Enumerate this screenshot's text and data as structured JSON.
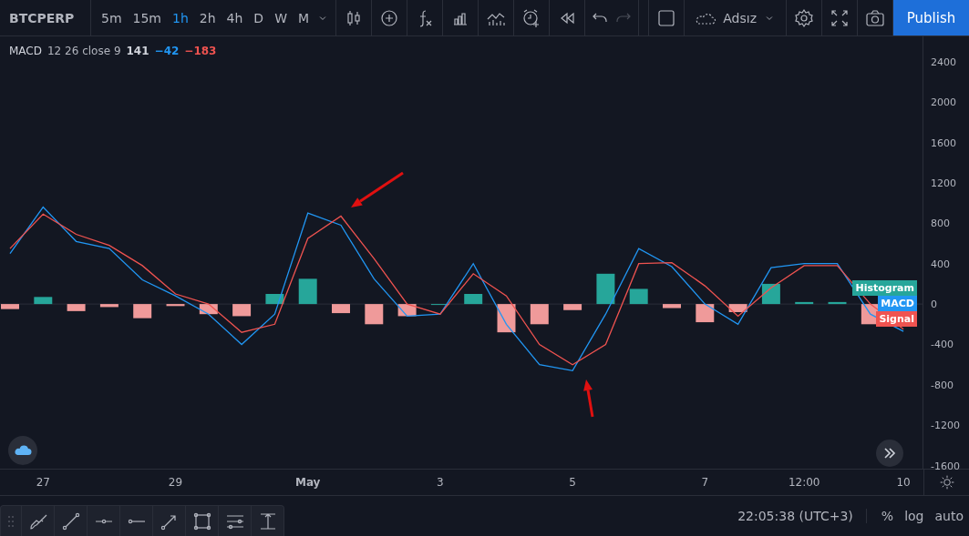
{
  "toolbar": {
    "symbol": "BTCPERP",
    "intervals": [
      {
        "label": "5m",
        "selected": false
      },
      {
        "label": "15m",
        "selected": false
      },
      {
        "label": "1h",
        "selected": true
      },
      {
        "label": "2h",
        "selected": false
      },
      {
        "label": "4h",
        "selected": false
      },
      {
        "label": "D",
        "selected": false
      },
      {
        "label": "W",
        "selected": false
      },
      {
        "label": "M",
        "selected": false
      }
    ],
    "undo": {
      "disabled": false
    },
    "redo": {
      "disabled": true
    },
    "layout_name": "Adsız",
    "publish": "Publish"
  },
  "legend": {
    "name": "MACD",
    "params": "12 26 close 9",
    "values": [
      {
        "text": "141",
        "color": "#d1d4dc"
      },
      {
        "text": "−42",
        "color": "#2196f3"
      },
      {
        "text": "−183",
        "color": "#ef5350"
      }
    ]
  },
  "chart": {
    "chart_data": {
      "type": "line",
      "ylim": [
        -1630,
        2650
      ],
      "categories": [
        null,
        "27",
        null,
        null,
        null,
        "29",
        null,
        null,
        null,
        "May",
        null,
        null,
        null,
        "3",
        null,
        null,
        null,
        "5",
        null,
        null,
        null,
        "7",
        null,
        null,
        "12:00",
        null,
        null,
        "10"
      ],
      "series": [
        {
          "name": "Histogram",
          "type": "bar",
          "color": "#26a69a",
          "values": [
            null,
            70,
            null,
            null,
            null,
            null,
            null,
            null,
            100,
            250,
            null,
            null,
            null,
            0,
            100,
            null,
            null,
            null,
            300,
            150,
            null,
            null,
            null,
            200,
            20,
            20,
            null,
            null
          ]
        },
        {
          "type": "bar",
          "color": "#ef9a9a",
          "values": [
            -50,
            null,
            -70,
            -30,
            -140,
            -20,
            -100,
            -120,
            null,
            null,
            -90,
            -200,
            -120,
            null,
            null,
            -280,
            -200,
            -60,
            null,
            null,
            -40,
            -180,
            -80,
            null,
            null,
            null,
            -200,
            null
          ]
        },
        {
          "name": "MACD",
          "type": "line",
          "color": "#2196f3",
          "values": [
            500,
            960,
            620,
            550,
            240,
            80,
            -100,
            -400,
            -100,
            900,
            780,
            250,
            -120,
            -100,
            400,
            -200,
            -600,
            -660,
            -100,
            550,
            370,
            0,
            -200,
            360,
            400,
            400,
            -100,
            -270
          ]
        },
        {
          "name": "Signal",
          "type": "line",
          "color": "#ef5350",
          "values": [
            550,
            890,
            690,
            580,
            380,
            100,
            0,
            -280,
            -200,
            650,
            870,
            450,
            0,
            -100,
            300,
            80,
            -400,
            -600,
            -400,
            400,
            410,
            180,
            -120,
            160,
            380,
            380,
            0,
            -250
          ]
        }
      ],
      "yticks": [
        2400,
        2000,
        1600,
        1200,
        800,
        400,
        0,
        -400,
        -800,
        -1200,
        -1600
      ]
    }
  },
  "footer": {
    "time": "22:05:38 (UTC+3)",
    "buttons": [
      "%",
      "log",
      "auto"
    ]
  }
}
